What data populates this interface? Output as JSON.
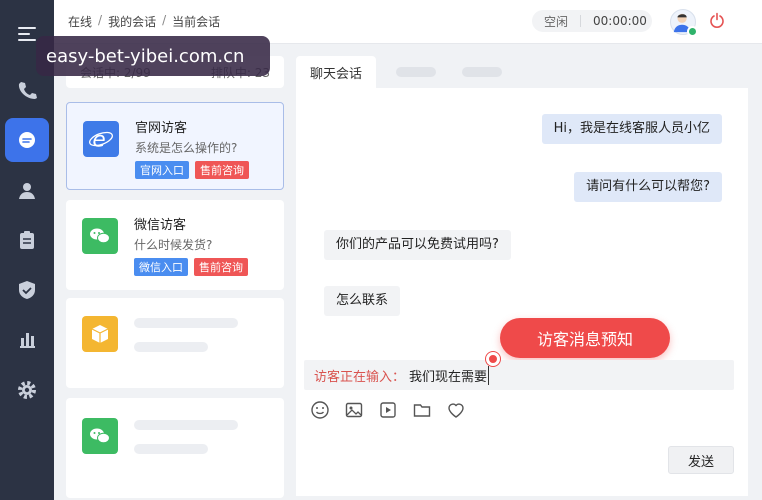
{
  "topbar": {
    "breadcrumb": [
      "在线",
      "我的会话",
      "当前会话"
    ],
    "status": "空闲",
    "timer": "00:00:00"
  },
  "watermark": "easy-bet-yibei.com.cn",
  "counts": {
    "in_session": "会话中: 2/99",
    "queue": "排队中: 23"
  },
  "sessions": [
    {
      "title": "官网访客",
      "subtitle": "系统是怎么操作的?",
      "tags": [
        "官网入口",
        "售前咨询"
      ],
      "icon": "ie-icon",
      "color": "#3f7be8"
    },
    {
      "title": "微信访客",
      "subtitle": "什么时候发货?",
      "tags": [
        "微信入口",
        "售前咨询"
      ],
      "icon": "wechat-icon",
      "color": "#3dbb63"
    },
    {
      "icon": "box-icon",
      "color": "#f4b631"
    },
    {
      "icon": "wechat-icon",
      "color": "#3dbb63"
    }
  ],
  "chat": {
    "tab_active": "聊天会话",
    "messages": [
      {
        "side": "out",
        "text": "Hi，我是在线客服人员小亿"
      },
      {
        "side": "out",
        "text": "请问有什么可以帮您?"
      },
      {
        "side": "in",
        "text": "你们的产品可以免费试用吗?"
      },
      {
        "side": "in",
        "text": "怎么联系"
      }
    ],
    "notify": "访客消息预知",
    "typing_label": "访客正在输入：",
    "typing_text": "我们现在需要",
    "send_label": "发送"
  },
  "colors": {
    "sidebar": "#2c3344",
    "accent": "#3d73ea",
    "alert": "#ef4a4a"
  }
}
